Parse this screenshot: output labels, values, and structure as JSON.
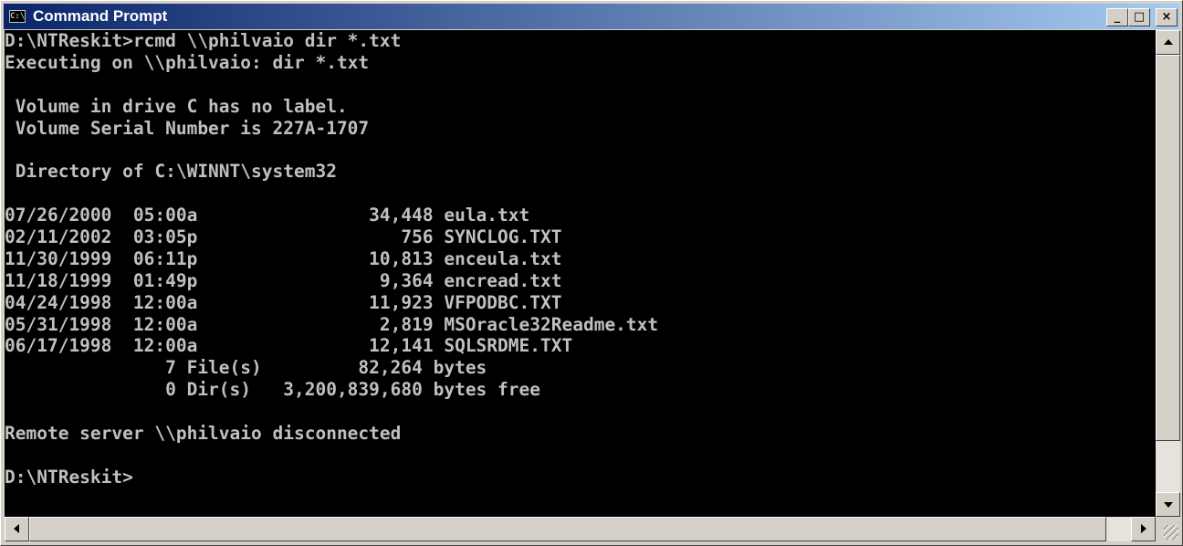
{
  "window": {
    "title": "Command Prompt",
    "icon_name": "console-app-icon",
    "icon_glyph": "C:\\",
    "controls": {
      "minimize": "_",
      "maximize": "□",
      "close": "×"
    }
  },
  "console": {
    "lines": [
      "D:\\NTReskit>rcmd \\\\philvaio dir *.txt",
      "Executing on \\\\philvaio: dir *.txt",
      "",
      " Volume in drive C has no label.",
      " Volume Serial Number is 227A-1707",
      "",
      " Directory of C:\\WINNT\\system32",
      "",
      "07/26/2000  05:00a                34,448 eula.txt",
      "02/11/2002  03:05p                   756 SYNCLOG.TXT",
      "11/30/1999  06:11p                10,813 enceula.txt",
      "11/18/1999  01:49p                 9,364 encread.txt",
      "04/24/1998  12:00a                11,923 VFPODBC.TXT",
      "05/31/1998  12:00a                 2,819 MSOracle32Readme.txt",
      "06/17/1998  12:00a                12,141 SQLSRDME.TXT",
      "               7 File(s)         82,264 bytes",
      "               0 Dir(s)   3,200,839,680 bytes free",
      "",
      "Remote server \\\\philvaio disconnected",
      "",
      "D:\\NTReskit>"
    ]
  },
  "colors": {
    "title_bar_start": "#0a246a",
    "title_bar_end": "#a6caf0",
    "console_background": "#000000",
    "console_text": "#c0c0c0",
    "chrome": "#d4d0c8"
  }
}
